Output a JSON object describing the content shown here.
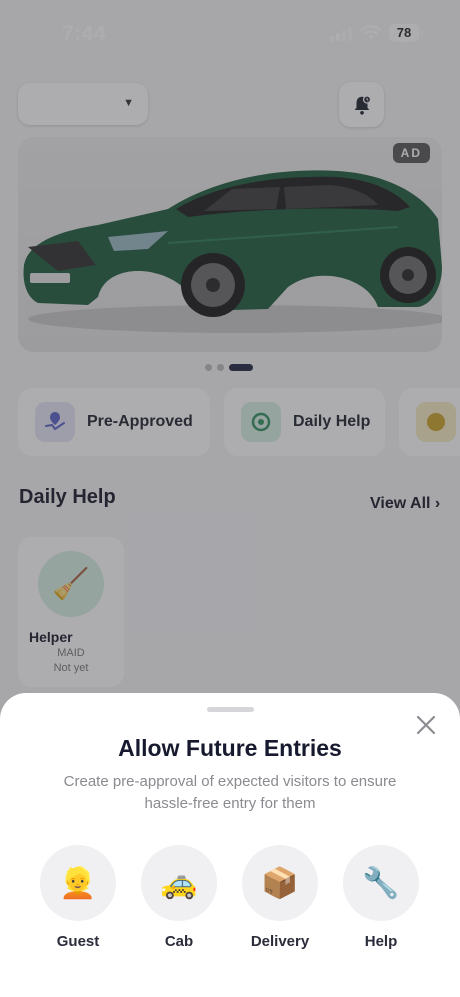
{
  "status_bar": {
    "time": "7:44",
    "battery": "78"
  },
  "ad": {
    "badge": "AD"
  },
  "quick_actions": [
    {
      "label": "Pre-Approved",
      "icon": "pre-approved-icon"
    },
    {
      "label": "Daily Help",
      "icon": "daily-help-icon"
    },
    {
      "label": "",
      "icon": "partial-action-icon"
    }
  ],
  "daily_help": {
    "title": "Daily Help",
    "view_all": "View All ›",
    "helpers": [
      {
        "name": "Helper",
        "role": "MAID",
        "status": "Not yet",
        "icon": "broom-icon"
      }
    ]
  },
  "sheet": {
    "title": "Allow Future Entries",
    "subtitle": "Create pre-approval of expected visitors to ensure hassle-free entry for them",
    "options": [
      {
        "label": "Guest",
        "emoji": "👱",
        "icon": "guest-icon"
      },
      {
        "label": "Cab",
        "emoji": "🚕",
        "icon": "cab-icon"
      },
      {
        "label": "Delivery",
        "emoji": "📦",
        "icon": "delivery-icon"
      },
      {
        "label": "Help",
        "emoji": "🔧",
        "icon": "wrench-icon"
      }
    ]
  },
  "colors": {
    "overlay": "#3c3c41",
    "accent_navy": "#1e2340",
    "car_green": "#1d5a3c",
    "helper_avatar_bg": "#d8efe3"
  }
}
